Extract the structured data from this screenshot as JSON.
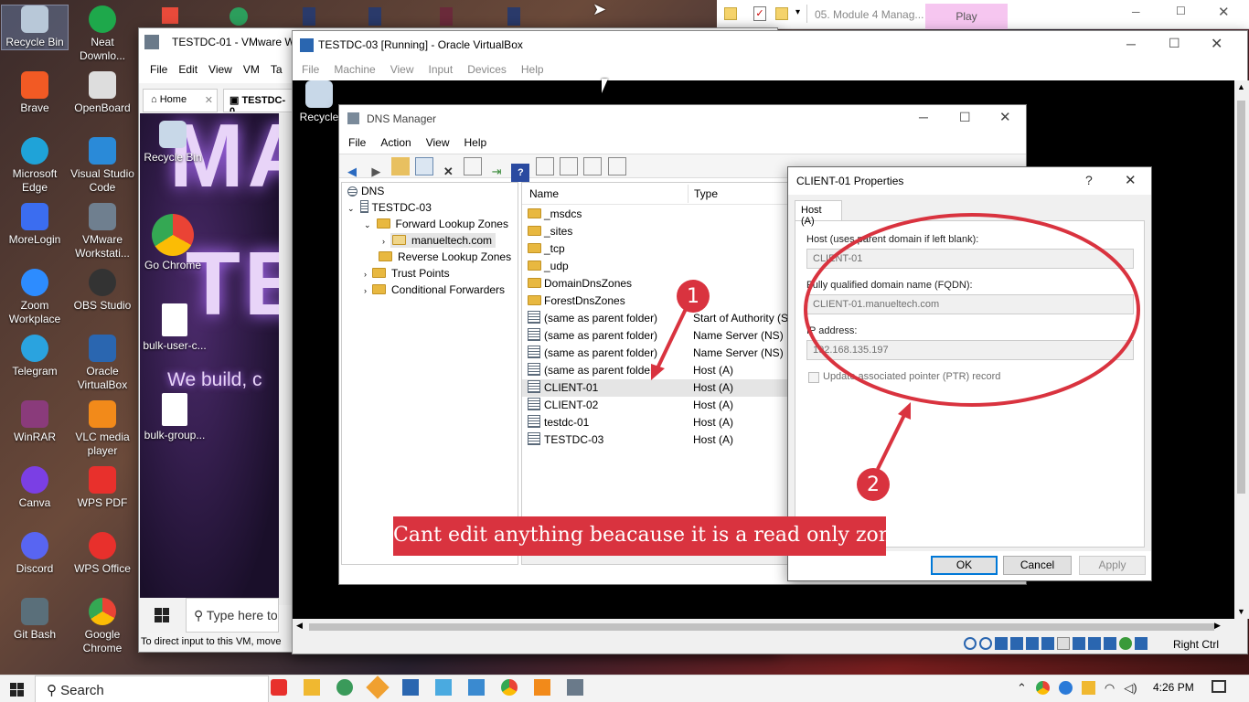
{
  "desktop": {
    "icons_col1": [
      "Recycle Bin",
      "Brave",
      "Microsoft Edge",
      "MoreLogin",
      "Zoom Workplace",
      "Telegram",
      "WinRAR",
      "Canva",
      "Discord",
      "Git Bash"
    ],
    "icons_col2": [
      "Neat Downlo...",
      "OpenBoard",
      "Visual Studio Code",
      "VMware Workstati...",
      "OBS Studio",
      "Oracle VirtualBox",
      "VLC media player",
      "WPS PDF",
      "WPS Office",
      "Google Chrome"
    ]
  },
  "explorer_bar": {
    "title": "05. Module 4 Manag...",
    "tab": "Play"
  },
  "vmware": {
    "title": "TESTDC-01 - VMware Wo",
    "menu": [
      "File",
      "Edit",
      "View",
      "VM",
      "Ta"
    ],
    "tabs": [
      "Home",
      "TESTDC-0"
    ],
    "guest_icons": [
      "Recycle Bin",
      "Go Chrome",
      "bulk-user-c...",
      "bulk-group..."
    ],
    "banner_text": "We build, c",
    "search_placeholder": "Type here to",
    "status": "To direct input to this VM, move"
  },
  "vbox": {
    "title": "TESTDC-03 [Running] - Oracle VirtualBox",
    "menu": [
      "File",
      "Machine",
      "View",
      "Input",
      "Devices",
      "Help"
    ],
    "guest_recycle": "Recycle",
    "status_right": "Right Ctrl"
  },
  "dns": {
    "title": "DNS Manager",
    "menu": [
      "File",
      "Action",
      "View",
      "Help"
    ],
    "tree": {
      "root": "DNS",
      "server": "TESTDC-03",
      "fwd": "Forward Lookup Zones",
      "zone": "manueltech.com",
      "rev": "Reverse Lookup Zones",
      "trust": "Trust Points",
      "cond": "Conditional Forwarders"
    },
    "columns": [
      "Name",
      "Type"
    ],
    "rows": [
      {
        "name": "_msdcs",
        "type": "",
        "kind": "folder"
      },
      {
        "name": "_sites",
        "type": "",
        "kind": "folder"
      },
      {
        "name": "_tcp",
        "type": "",
        "kind": "folder"
      },
      {
        "name": "_udp",
        "type": "",
        "kind": "folder"
      },
      {
        "name": "DomainDnsZones",
        "type": "",
        "kind": "folder"
      },
      {
        "name": "ForestDnsZones",
        "type": "",
        "kind": "folder"
      },
      {
        "name": "(same as parent folder)",
        "type": "Start of Authority (S",
        "kind": "record"
      },
      {
        "name": "(same as parent folder)",
        "type": "Name Server (NS)",
        "kind": "record"
      },
      {
        "name": "(same as parent folder)",
        "type": "Name Server (NS)",
        "kind": "record"
      },
      {
        "name": "(same as parent folder)",
        "type": "Host (A)",
        "kind": "record"
      },
      {
        "name": "CLIENT-01",
        "type": "Host (A)",
        "kind": "record"
      },
      {
        "name": "CLIENT-02",
        "type": "Host (A)",
        "kind": "record"
      },
      {
        "name": "testdc-01",
        "type": "Host (A)",
        "kind": "record"
      },
      {
        "name": "TESTDC-03",
        "type": "Host (A)",
        "kind": "record"
      }
    ]
  },
  "props": {
    "title": "CLIENT-01 Properties",
    "help": "?",
    "tab": "Host (A)",
    "host_label": "Host (uses parent domain if left blank):",
    "host_value": "CLIENT-01",
    "fqdn_label": "Fully qualified domain name (FQDN):",
    "fqdn_value": "CLIENT-01.manueltech.com",
    "ip_label": "IP address:",
    "ip_value": "192.168.135.197",
    "ptr_label": "Update associated pointer (PTR) record",
    "ok": "OK",
    "cancel": "Cancel",
    "apply": "Apply"
  },
  "annotation": {
    "badge1": "1",
    "badge2": "2",
    "caption": "Cant edit anything beacause it is a read only zone",
    "color": "#d9333f"
  },
  "taskbar": {
    "search": "Search",
    "time": "4:26 PM"
  }
}
